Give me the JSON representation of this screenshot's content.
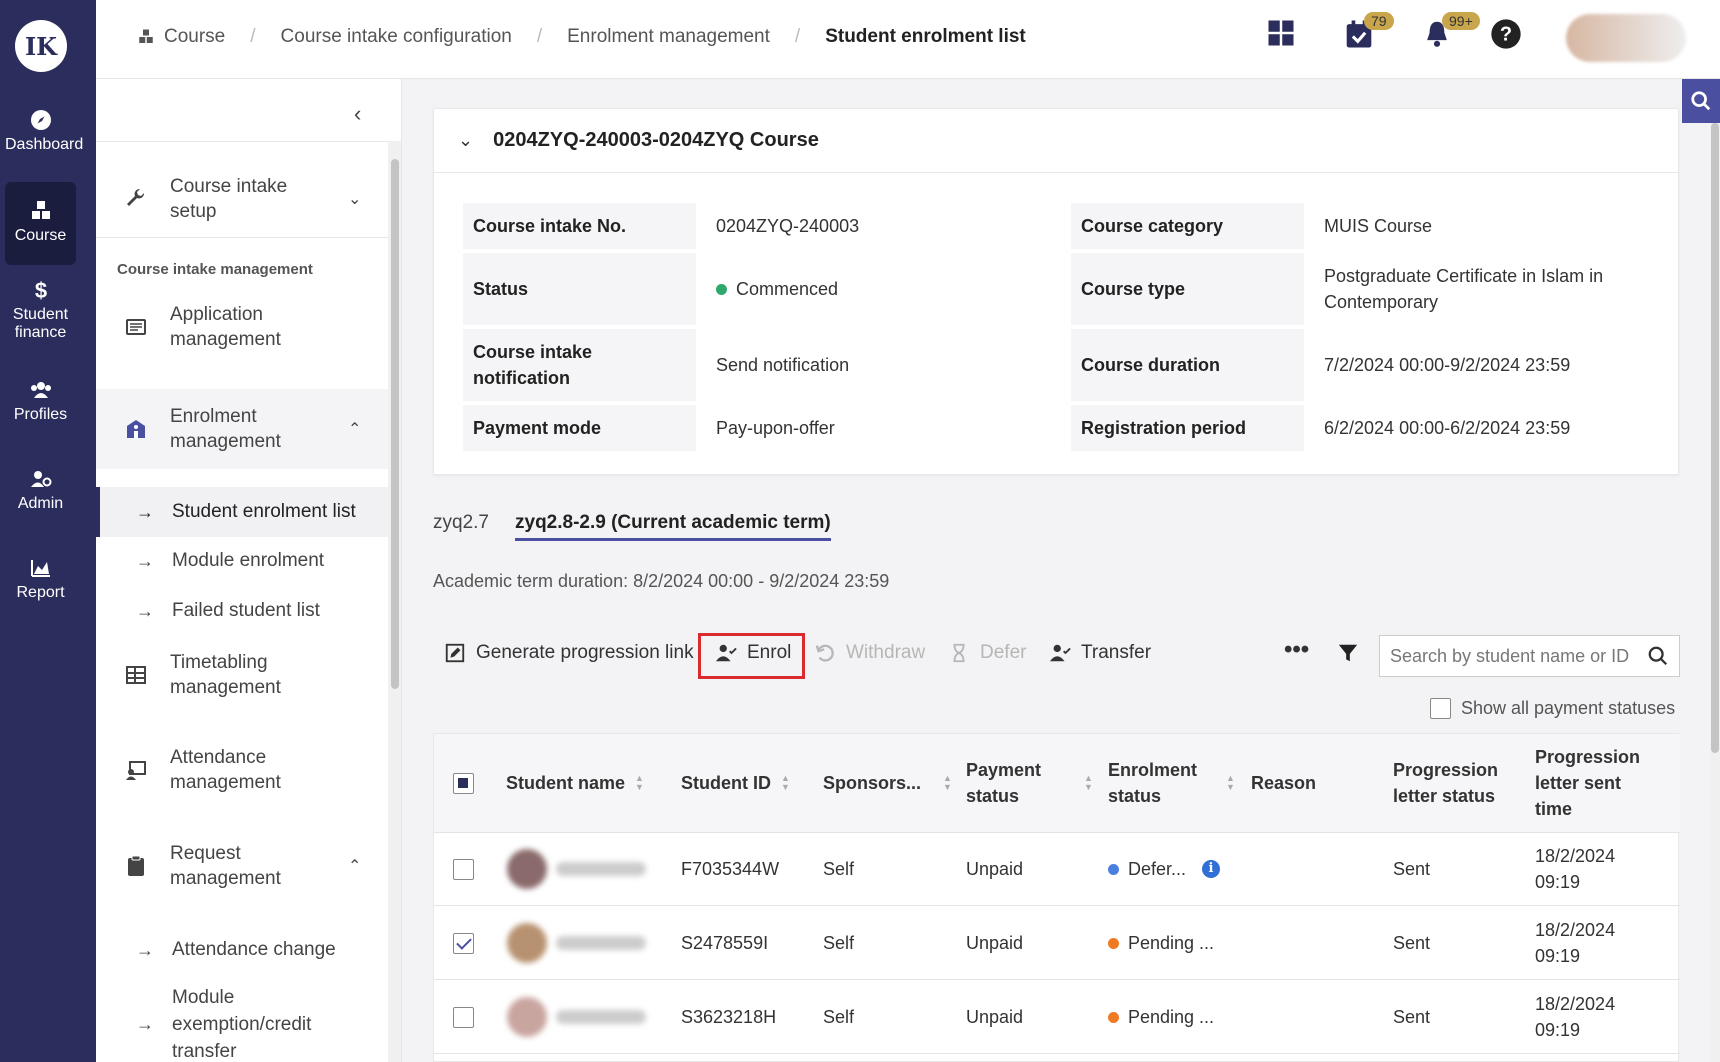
{
  "rail": {
    "logo_text": "IK",
    "items": [
      {
        "label": "Dashboard",
        "icon": "compass-icon"
      },
      {
        "label": "Course",
        "icon": "cubes-icon",
        "active": true
      },
      {
        "label": "Student finance",
        "icon": "dollar-icon"
      },
      {
        "label": "Profiles",
        "icon": "users-icon"
      },
      {
        "label": "Admin",
        "icon": "user-gear-icon"
      },
      {
        "label": "Report",
        "icon": "chart-icon"
      }
    ]
  },
  "breadcrumb": {
    "items": [
      "Course",
      "Course intake configuration",
      "Enrolment management"
    ],
    "current": "Student enrolment list"
  },
  "top_icons": {
    "tasks_badge": "79",
    "notifications_badge": "99+"
  },
  "sidenav": {
    "course_intake_setup": "Course intake setup",
    "section_label": "Course intake management",
    "application_management": "Application management",
    "enrolment_management": "Enrolment management",
    "enrolment_sub": [
      "Student enrolment list",
      "Module enrolment",
      "Failed student list"
    ],
    "timetabling_management": "Timetabling management",
    "attendance_management": "Attendance management",
    "request_management": "Request management",
    "request_sub": [
      "Attendance change",
      "Module exemption/credit transfer"
    ]
  },
  "course": {
    "title": "0204ZYQ-240003-0204ZYQ Course",
    "fields": {
      "intake_no_label": "Course intake No.",
      "intake_no": "0204ZYQ-240003",
      "status_label": "Status",
      "status": "Commenced",
      "notification_label": "Course intake notification",
      "notification": "Send notification",
      "payment_mode_label": "Payment mode",
      "payment_mode": "Pay-upon-offer",
      "category_label": "Course category",
      "category": "MUIS Course",
      "type_label": "Course type",
      "type": "Postgraduate Certificate in Islam in Contemporary",
      "duration_label": "Course duration",
      "duration": "7/2/2024 00:00-9/2/2024 23:59",
      "registration_label": "Registration period",
      "registration": "6/2/2024 00:00-6/2/2024 23:59"
    },
    "status_color": "#2ea96b"
  },
  "tabs": [
    "zyq2.7",
    "zyq2.8-2.9 (Current academic term)"
  ],
  "term_duration": "Academic term duration: 8/2/2024 00:00 - 9/2/2024 23:59",
  "toolbar": {
    "generate": "Generate progression link",
    "enrol": "Enrol",
    "withdraw": "Withdraw",
    "defer": "Defer",
    "transfer": "Transfer",
    "search_placeholder": "Search by student name or ID",
    "show_all": "Show all payment statuses"
  },
  "table": {
    "headers": {
      "name": "Student name",
      "id": "Student ID",
      "sponsor": "Sponsors...",
      "payment": "Payment status",
      "enrolment": "Enrolment status",
      "reason": "Reason",
      "letter": "Progression letter status",
      "sent_time": "Progression letter sent time"
    },
    "rows": [
      {
        "id": "F7035344W",
        "sponsor": "Self",
        "payment": "Unpaid",
        "enrolment": "Defer...",
        "letter": "Sent",
        "time": "18/2/2024 09:19",
        "checked": false
      },
      {
        "id": "S2478559I",
        "sponsor": "Self",
        "payment": "Unpaid",
        "enrolment": "Pending ...",
        "letter": "Sent",
        "time": "18/2/2024 09:19",
        "checked": true
      },
      {
        "id": "S3623218H",
        "sponsor": "Self",
        "payment": "Unpaid",
        "enrolment": "Pending ...",
        "letter": "Sent",
        "time": "18/2/2024 09:19",
        "checked": false
      }
    ]
  },
  "colors": {
    "primary": "#2b2e5c",
    "accent": "#4b4fa0",
    "deferred": "#4a7fe0",
    "pending": "#f07a21",
    "highlight": "#d92b2b"
  }
}
